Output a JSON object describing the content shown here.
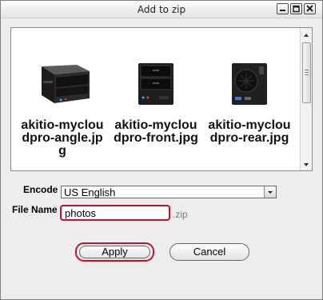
{
  "window": {
    "title": "Add to zip",
    "controls": [
      "minimize-icon",
      "maximize-icon",
      "close-icon"
    ]
  },
  "files": [
    {
      "name": "akitio-mycloudpro-angle.jpg"
    },
    {
      "name": "akitio-mycloudpro-front.jpg"
    },
    {
      "name": "akitio-mycloudpro-rear.jpg"
    }
  ],
  "form": {
    "encode_label": "Encode",
    "encode_value": "US English",
    "filename_label": "File Name",
    "filename_value": "photos",
    "extension": ".zip"
  },
  "buttons": {
    "apply": "Apply",
    "cancel": "Cancel"
  }
}
